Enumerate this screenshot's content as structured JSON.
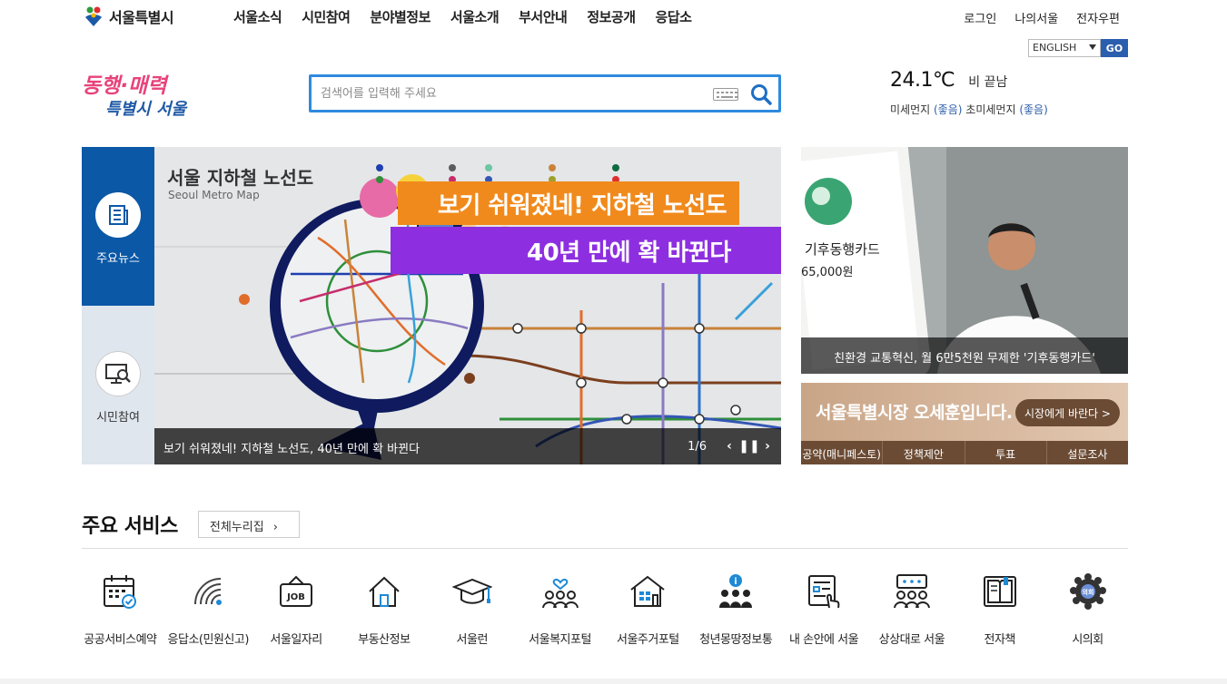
{
  "logo": {
    "text": "서울특별시"
  },
  "gnb": [
    "서울소식",
    "시민참여",
    "분야별정보",
    "서울소개",
    "부서안내",
    "정보공개",
    "응답소"
  ],
  "util": [
    "로그인",
    "나의서울",
    "전자우편"
  ],
  "language": {
    "selected": "ENGLISH",
    "go_label": "GO"
  },
  "slogan": {
    "line1": "동행·매력",
    "line2": "특별시 서울"
  },
  "search": {
    "placeholder": "검색어를 입력해 주세요"
  },
  "weather": {
    "temp": "24.1℃",
    "condition": "비 끝남",
    "dust_label": "미세먼지",
    "dust_value": "(좋음)",
    "fine_dust_label": "초미세먼지",
    "fine_dust_value": "(좋음)"
  },
  "side_tabs": [
    {
      "label": "주요뉴스",
      "active": true
    },
    {
      "label": "시민참여",
      "active": false
    }
  ],
  "banner": {
    "map_title": "서울 지하철 노선도",
    "map_subtitle": "Seoul Metro Map",
    "headline1": "보기 쉬워졌네! 지하철 노선도",
    "headline2": "40년 만에 확 바뀐다",
    "caption": "보기 쉬워졌네! 지하철 노선도, 40년 만에 확 바뀐다",
    "counter": "1/6",
    "colors": {
      "orange": "#f18a1c",
      "purple": "#8d2fe0",
      "navy": "#0f1b5e"
    }
  },
  "side_promo": {
    "caption": "친환경 교통혁신, 월 6만5천원 무제한 '기후동행카드'",
    "card_text": "기후동행카드",
    "card_price": "65,000원"
  },
  "mayor": {
    "title": "서울특별시장 오세훈입니다.",
    "button": "시장에게 바란다 >",
    "links": [
      "공약(매니페스토)",
      "정책제안",
      "투표",
      "설문조사"
    ]
  },
  "services": {
    "title": "주요 서비스",
    "all_button": "전체누리집",
    "items": [
      {
        "label": "공공서비스예약",
        "icon": "calendar-check-icon"
      },
      {
        "label": "응답소(민원신고)",
        "icon": "signal-icon"
      },
      {
        "label": "서울일자리",
        "icon": "job-sign-icon"
      },
      {
        "label": "부동산정보",
        "icon": "house-icon"
      },
      {
        "label": "서울런",
        "icon": "graduation-cap-icon"
      },
      {
        "label": "서울복지포털",
        "icon": "people-heart-icon"
      },
      {
        "label": "서울주거포털",
        "icon": "building-icon"
      },
      {
        "label": "청년몽땅정보통",
        "icon": "youth-info-icon"
      },
      {
        "label": "내 손안에 서울",
        "icon": "tablet-hand-icon"
      },
      {
        "label": "상상대로 서울",
        "icon": "idea-board-icon"
      },
      {
        "label": "전자책",
        "icon": "ebook-icon"
      },
      {
        "label": "시의회",
        "icon": "council-emblem-icon"
      }
    ]
  }
}
